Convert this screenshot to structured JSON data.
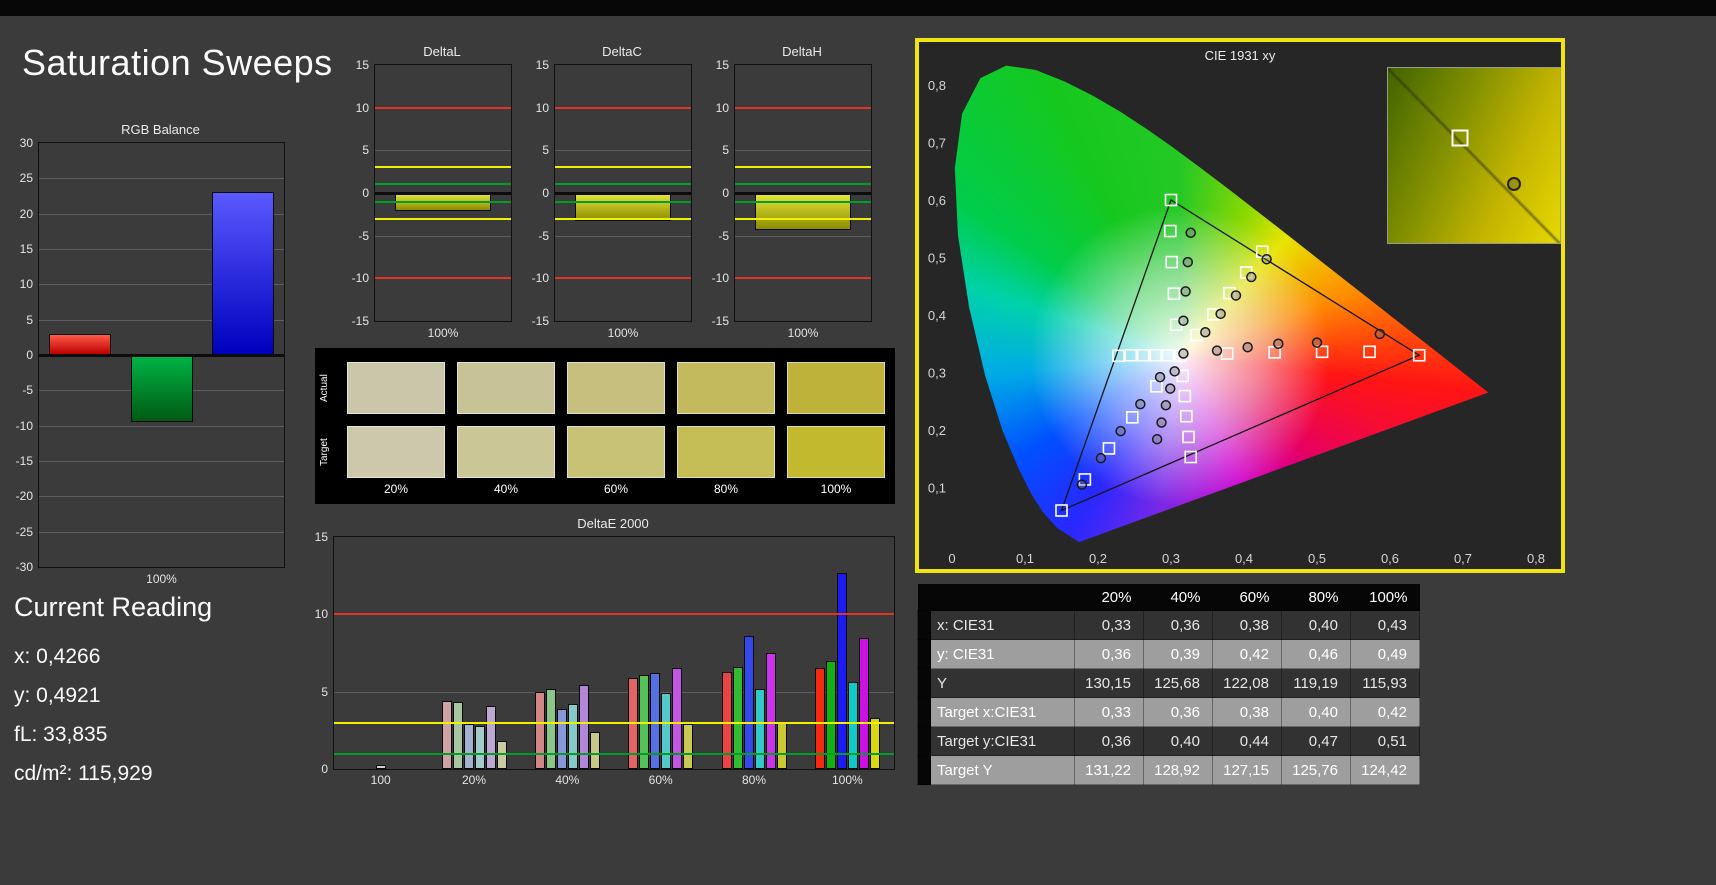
{
  "page": {
    "title": "Saturation Sweeps"
  },
  "colors": {
    "background": "#3b3b3b",
    "cie_panel_border": "#efe412",
    "guide_red": "#e03424",
    "guide_yellow": "#f0f000",
    "guide_green": "#00a028"
  },
  "current_reading": {
    "title": "Current Reading",
    "lines": [
      {
        "label": "x:",
        "value": "0,4266"
      },
      {
        "label": "y:",
        "value": "0,4921"
      },
      {
        "label": "fL:",
        "value": "33,835"
      },
      {
        "label": "cd/m²:",
        "value": "115,929"
      }
    ]
  },
  "swatches": {
    "row_labels": [
      "Actual",
      "Target"
    ],
    "col_labels": [
      "20%",
      "40%",
      "60%",
      "80%",
      "100%"
    ],
    "actual": [
      "#c9c6a9",
      "#c8c396",
      "#c6bf7d",
      "#c3ba5e",
      "#beb23a"
    ],
    "target": [
      "#cbc8ab",
      "#cac695",
      "#c8c277",
      "#c5bd55",
      "#c3b92e"
    ]
  },
  "table": {
    "col_headers": [
      "20%",
      "40%",
      "60%",
      "80%",
      "100%"
    ],
    "rows": [
      {
        "label": "x: CIE31",
        "values": [
          "0,33",
          "0,36",
          "0,38",
          "0,40",
          "0,43"
        ]
      },
      {
        "label": "y: CIE31",
        "values": [
          "0,36",
          "0,39",
          "0,42",
          "0,46",
          "0,49"
        ]
      },
      {
        "label": "Y",
        "values": [
          "130,15",
          "125,68",
          "122,08",
          "119,19",
          "115,93"
        ]
      },
      {
        "label": "Target x:CIE31",
        "values": [
          "0,33",
          "0,36",
          "0,38",
          "0,40",
          "0,42"
        ]
      },
      {
        "label": "Target y:CIE31",
        "values": [
          "0,36",
          "0,40",
          "0,44",
          "0,47",
          "0,51"
        ]
      },
      {
        "label": "Target Y",
        "values": [
          "131,22",
          "128,92",
          "127,15",
          "125,76",
          "124,42"
        ]
      }
    ]
  },
  "chart_data": [
    {
      "id": "rgb-balance",
      "type": "bar",
      "title": "RGB Balance",
      "xlabel": "100%",
      "categories": [
        "red",
        "green",
        "blue"
      ],
      "values": [
        3,
        -9.5,
        23
      ],
      "bar_colors": [
        [
          "#ff5a4a",
          "#bb0000"
        ],
        [
          "#00b446",
          "#005a14"
        ],
        [
          "#5a5aff",
          "#0000be"
        ]
      ],
      "ylim": [
        -30,
        30
      ],
      "ytick_step": 5,
      "zero_band": true
    },
    {
      "id": "delta-l",
      "type": "bar",
      "title": "DeltaL",
      "xlabel": "100%",
      "categories": [
        "100%"
      ],
      "values": [
        -2.1
      ],
      "bar_colors": [
        [
          "#e6e63c",
          "#8c8c00"
        ]
      ],
      "ylim": [
        -15,
        15
      ],
      "ytick_step": 5,
      "zero_band": true,
      "guides": [
        {
          "y": 10,
          "color": "#e03424"
        },
        {
          "y": -10,
          "color": "#e03424"
        },
        {
          "y": 3,
          "color": "#f0f000"
        },
        {
          "y": -3,
          "color": "#f0f000"
        },
        {
          "y": 1,
          "color": "#00a028"
        },
        {
          "y": -1,
          "color": "#00a028"
        }
      ]
    },
    {
      "id": "delta-c",
      "type": "bar",
      "title": "DeltaC",
      "xlabel": "100%",
      "categories": [
        "100%"
      ],
      "values": [
        -3.3
      ],
      "bar_colors": [
        [
          "#e6e63c",
          "#8c8c00"
        ]
      ],
      "ylim": [
        -15,
        15
      ],
      "ytick_step": 5,
      "zero_band": true,
      "guides": [
        {
          "y": 10,
          "color": "#e03424"
        },
        {
          "y": -10,
          "color": "#e03424"
        },
        {
          "y": 3,
          "color": "#f0f000"
        },
        {
          "y": -3,
          "color": "#f0f000"
        },
        {
          "y": 1,
          "color": "#00a028"
        },
        {
          "y": -1,
          "color": "#00a028"
        }
      ]
    },
    {
      "id": "delta-h",
      "type": "bar",
      "title": "DeltaH",
      "xlabel": "100%",
      "categories": [
        "100%"
      ],
      "values": [
        -4.3
      ],
      "bar_colors": [
        [
          "#e6e63c",
          "#8c8c00"
        ]
      ],
      "ylim": [
        -15,
        15
      ],
      "ytick_step": 5,
      "zero_band": true,
      "guides": [
        {
          "y": 10,
          "color": "#e03424"
        },
        {
          "y": -10,
          "color": "#e03424"
        },
        {
          "y": 3,
          "color": "#f0f000"
        },
        {
          "y": -3,
          "color": "#f0f000"
        },
        {
          "y": 1,
          "color": "#00a028"
        },
        {
          "y": -1,
          "color": "#00a028"
        }
      ]
    },
    {
      "id": "delta-e",
      "type": "grouped-bar",
      "title": "DeltaE 2000",
      "ylim": [
        0,
        15
      ],
      "ytick_step": 5,
      "guides": [
        {
          "y": 10,
          "color": "#e03424"
        },
        {
          "y": 3,
          "color": "#f0f000"
        },
        {
          "y": 1,
          "color": "#00a028"
        }
      ],
      "groups": [
        {
          "label": "100",
          "bars": [
            {
              "v": 0.25,
              "c": "#d0d0d0"
            }
          ]
        },
        {
          "label": "20%",
          "bars": [
            {
              "v": 4.4,
              "c": "#cfa3a3"
            },
            {
              "v": 4.3,
              "c": "#a9c6a2"
            },
            {
              "v": 2.9,
              "c": "#a2b2cf"
            },
            {
              "v": 2.8,
              "c": "#a4cbcb"
            },
            {
              "v": 4.1,
              "c": "#bca9d2"
            },
            {
              "v": 1.8,
              "c": "#cbcba2"
            }
          ]
        },
        {
          "label": "40%",
          "bars": [
            {
              "v": 5.0,
              "c": "#d28787"
            },
            {
              "v": 5.2,
              "c": "#8ac687"
            },
            {
              "v": 3.9,
              "c": "#8797d8"
            },
            {
              "v": 4.2,
              "c": "#87c9c9"
            },
            {
              "v": 5.4,
              "c": "#b287d8"
            },
            {
              "v": 2.4,
              "c": "#c9c987"
            }
          ]
        },
        {
          "label": "60%",
          "bars": [
            {
              "v": 5.9,
              "c": "#e26464"
            },
            {
              "v": 6.1,
              "c": "#55c255"
            },
            {
              "v": 6.2,
              "c": "#5570e2"
            },
            {
              "v": 4.9,
              "c": "#55c9c9"
            },
            {
              "v": 6.5,
              "c": "#c255e2"
            },
            {
              "v": 2.9,
              "c": "#c9c955"
            }
          ]
        },
        {
          "label": "80%",
          "bars": [
            {
              "v": 6.3,
              "c": "#ea4343"
            },
            {
              "v": 6.6,
              "c": "#33bb33"
            },
            {
              "v": 8.6,
              "c": "#3349ea"
            },
            {
              "v": 5.2,
              "c": "#33c9c9"
            },
            {
              "v": 7.5,
              "c": "#c933ea"
            },
            {
              "v": 3.0,
              "c": "#c9c933"
            }
          ]
        },
        {
          "label": "100%",
          "bars": [
            {
              "v": 6.5,
              "c": "#f22b12"
            },
            {
              "v": 7.0,
              "c": "#12b012"
            },
            {
              "v": 12.7,
              "c": "#1b1bf2"
            },
            {
              "v": 5.6,
              "c": "#12c9c9"
            },
            {
              "v": 8.5,
              "c": "#c912e2"
            },
            {
              "v": 3.3,
              "c": "#d8d812"
            }
          ]
        }
      ]
    },
    {
      "id": "cie",
      "type": "scatter",
      "title": "CIE 1931 xy",
      "xlim": [
        0,
        0.85
      ],
      "ylim": [
        0,
        0.87
      ],
      "xticks": [
        {
          "v": 0,
          "l": "0"
        },
        {
          "v": 0.1,
          "l": "0,1"
        },
        {
          "v": 0.2,
          "l": "0,2"
        },
        {
          "v": 0.3,
          "l": "0,3"
        },
        {
          "v": 0.4,
          "l": "0,4"
        },
        {
          "v": 0.5,
          "l": "0,5"
        },
        {
          "v": 0.6,
          "l": "0,6"
        },
        {
          "v": 0.7,
          "l": "0,7"
        },
        {
          "v": 0.8,
          "l": "0,8"
        }
      ],
      "yticks": [
        {
          "v": 0.1,
          "l": "0,1"
        },
        {
          "v": 0.2,
          "l": "0,2"
        },
        {
          "v": 0.3,
          "l": "0,3"
        },
        {
          "v": 0.4,
          "l": "0,4"
        },
        {
          "v": 0.5,
          "l": "0,5"
        },
        {
          "v": 0.6,
          "l": "0,6"
        },
        {
          "v": 0.7,
          "l": "0,7"
        },
        {
          "v": 0.8,
          "l": "0,8"
        }
      ],
      "white_point": [
        0.3127,
        0.329
      ],
      "gamut_triangle": [
        [
          0.64,
          0.33
        ],
        [
          0.3,
          0.6
        ],
        [
          0.15,
          0.06
        ]
      ],
      "locus": [
        [
          0.1741,
          0.005
        ],
        [
          0.144,
          0.0297
        ],
        [
          0.1241,
          0.0578
        ],
        [
          0.1096,
          0.0868
        ],
        [
          0.0913,
          0.1327
        ],
        [
          0.0687,
          0.2007
        ],
        [
          0.0454,
          0.295
        ],
        [
          0.0235,
          0.4127
        ],
        [
          0.0082,
          0.5384
        ],
        [
          0.0039,
          0.6548
        ],
        [
          0.0139,
          0.7502
        ],
        [
          0.0389,
          0.812
        ],
        [
          0.0743,
          0.8338
        ],
        [
          0.1142,
          0.8262
        ],
        [
          0.1547,
          0.8059
        ],
        [
          0.1929,
          0.7816
        ],
        [
          0.2296,
          0.7543
        ],
        [
          0.2658,
          0.7243
        ],
        [
          0.3016,
          0.6923
        ],
        [
          0.3373,
          0.6589
        ],
        [
          0.3731,
          0.6245
        ],
        [
          0.4087,
          0.5896
        ],
        [
          0.4441,
          0.5547
        ],
        [
          0.4788,
          0.5202
        ],
        [
          0.5125,
          0.4866
        ],
        [
          0.5448,
          0.4544
        ],
        [
          0.5752,
          0.4242
        ],
        [
          0.6029,
          0.3965
        ],
        [
          0.627,
          0.3725
        ],
        [
          0.6482,
          0.3514
        ],
        [
          0.6658,
          0.334
        ],
        [
          0.6915,
          0.3083
        ],
        [
          0.714,
          0.2859
        ],
        [
          0.7347,
          0.2653
        ]
      ],
      "targets": [
        [
          0.3127,
          0.329
        ],
        [
          0.296,
          0.33
        ],
        [
          0.279,
          0.33
        ],
        [
          0.262,
          0.33
        ],
        [
          0.245,
          0.33
        ],
        [
          0.228,
          0.329
        ],
        [
          0.377,
          0.333
        ],
        [
          0.442,
          0.335
        ],
        [
          0.507,
          0.336
        ],
        [
          0.572,
          0.336
        ],
        [
          0.64,
          0.33
        ],
        [
          0.307,
          0.383
        ],
        [
          0.304,
          0.437
        ],
        [
          0.301,
          0.492
        ],
        [
          0.299,
          0.546
        ],
        [
          0.3,
          0.6
        ],
        [
          0.335,
          0.365
        ],
        [
          0.358,
          0.401
        ],
        [
          0.38,
          0.438
        ],
        [
          0.403,
          0.474
        ],
        [
          0.425,
          0.51
        ],
        [
          0.28,
          0.276
        ],
        [
          0.247,
          0.222
        ],
        [
          0.215,
          0.168
        ],
        [
          0.182,
          0.114
        ],
        [
          0.15,
          0.06
        ],
        [
          0.316,
          0.294
        ],
        [
          0.319,
          0.259
        ],
        [
          0.321,
          0.224
        ],
        [
          0.324,
          0.188
        ],
        [
          0.327,
          0.153
        ]
      ],
      "measured": [
        [
          0.317,
          0.333
        ],
        [
          0.363,
          0.338
        ],
        [
          0.405,
          0.344
        ],
        [
          0.447,
          0.35
        ],
        [
          0.5,
          0.352
        ],
        [
          0.586,
          0.367
        ],
        [
          0.317,
          0.39
        ],
        [
          0.32,
          0.441
        ],
        [
          0.323,
          0.492
        ],
        [
          0.327,
          0.543
        ],
        [
          0.347,
          0.37
        ],
        [
          0.368,
          0.402
        ],
        [
          0.389,
          0.434
        ],
        [
          0.41,
          0.466
        ],
        [
          0.431,
          0.497
        ],
        [
          0.285,
          0.292
        ],
        [
          0.258,
          0.245
        ],
        [
          0.231,
          0.198
        ],
        [
          0.204,
          0.151
        ],
        [
          0.178,
          0.105
        ],
        [
          0.305,
          0.302
        ],
        [
          0.299,
          0.272
        ],
        [
          0.293,
          0.243
        ],
        [
          0.287,
          0.213
        ],
        [
          0.281,
          0.184
        ]
      ],
      "inset": {
        "square": [
          0.42,
          0.4
        ],
        "circle": [
          0.73,
          0.66
        ]
      }
    }
  ]
}
